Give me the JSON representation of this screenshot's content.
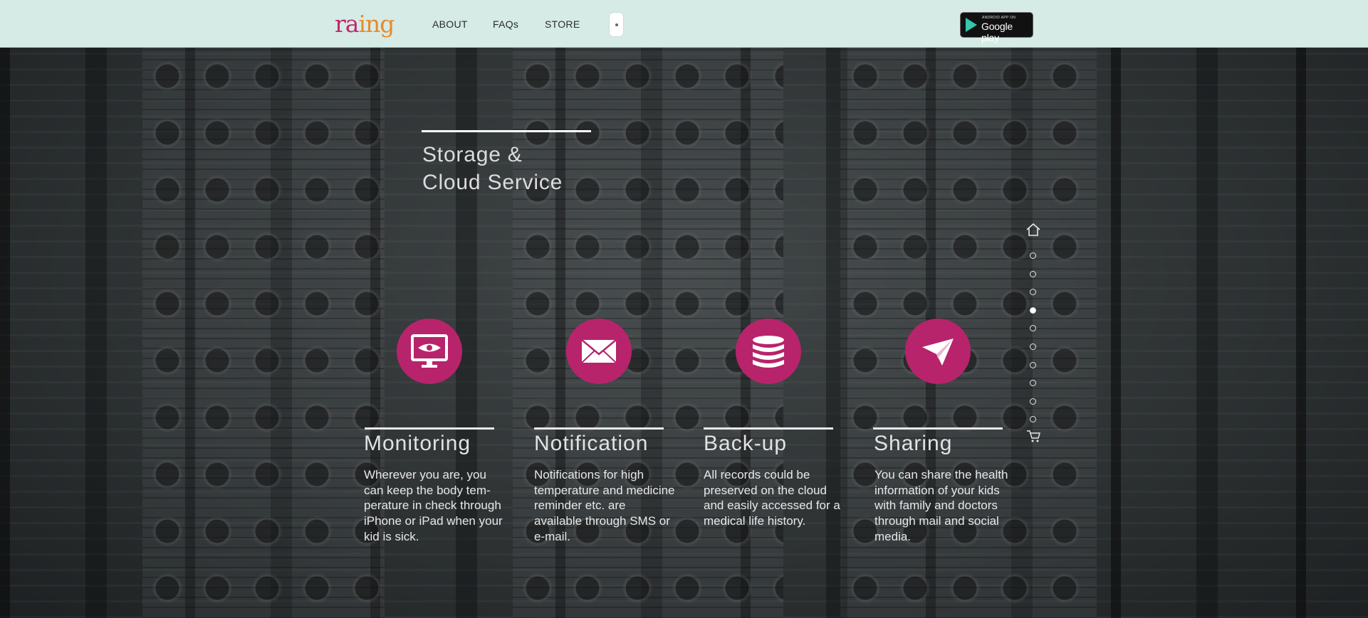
{
  "header": {
    "logo": {
      "part1": "ra",
      "part2": "i",
      "part3": "ng"
    },
    "nav": [
      "ABOUT",
      "FAQs",
      "STORE"
    ],
    "plus_label": "+",
    "google_play": {
      "small": "ANDROID APP ON",
      "big": "Google play"
    }
  },
  "hero": {
    "headline_line1": "Storage &",
    "headline_line2": "Cloud Service"
  },
  "features": [
    {
      "title": "Monitoring",
      "icon": "monitor-eye-icon",
      "description": "Wherever you are, you can keep the body tem-perature in check through iPhone or iPad when your kid is sick."
    },
    {
      "title": "Notification",
      "icon": "envelope-icon",
      "description": "Notifications for high temperature and medicine reminder etc. are available through SMS or e-mail."
    },
    {
      "title": "Back-up",
      "icon": "database-icon",
      "description": "All records could be preserved on the cloud and easily accessed for a medical life history."
    },
    {
      "title": "Sharing",
      "icon": "paper-plane-icon",
      "description": "You can share the health information of your kids with family and doctors through mail and social media."
    }
  ],
  "side_nav": {
    "top_icon": "home-icon",
    "dot_count": 10,
    "active_index": 3,
    "bottom_icon": "cart-icon"
  },
  "colors": {
    "accent": "#b7246b",
    "header_bg": "#d6ebe5",
    "logo_pink": "#c0276e",
    "logo_orange": "#e88a2a"
  }
}
